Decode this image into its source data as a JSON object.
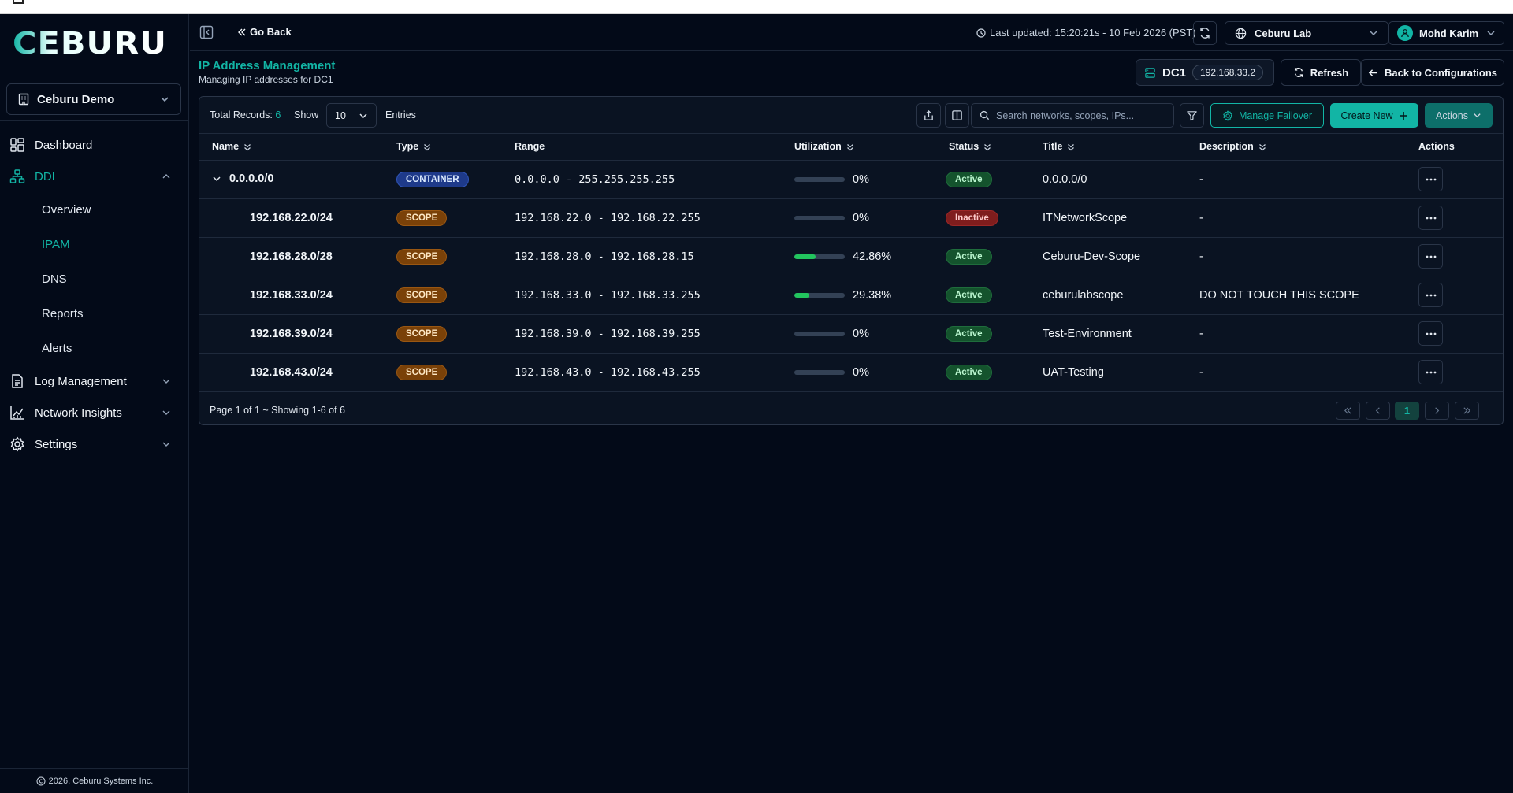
{
  "brand": {
    "logo_text": "CEBURU",
    "accent": "#12b5a5"
  },
  "org_selector": {
    "value": "Ceburu Demo",
    "icon": "building-icon"
  },
  "sidebar": {
    "items": [
      {
        "label": "Dashboard",
        "icon": "dashboard-icon"
      },
      {
        "label": "DDI",
        "icon": "network-icon",
        "expanded": true
      },
      {
        "label": "Log Management",
        "icon": "document-icon"
      },
      {
        "label": "Network Insights",
        "icon": "chart-icon"
      },
      {
        "label": "Settings",
        "icon": "gear-icon"
      }
    ],
    "ddi_sub": [
      "Overview",
      "IPAM",
      "DNS",
      "Reports",
      "Alerts"
    ],
    "active_sub": "IPAM"
  },
  "footer": {
    "text": "2026, Ceburu Systems Inc."
  },
  "topbar": {
    "go_back": "Go Back",
    "last_updated": "Last updated: 15:20:21s - 10 Feb 2026 (PST)",
    "lab": "Ceburu Lab",
    "user": "Mohd Karim"
  },
  "page": {
    "title": "IP Address Management",
    "subtitle": "Managing IP addresses for DC1",
    "dc_name": "DC1",
    "dc_ip": "192.168.33.2",
    "refresh_label": "Refresh",
    "back_label": "Back to Configurations"
  },
  "toolbar": {
    "total_label": "Total Records:",
    "total_value": "6",
    "show_label": "Show",
    "show_value": "10",
    "entries_label": "Entries",
    "search_placeholder": "Search networks, scopes, IPs...",
    "manage_failover": "Manage Failover",
    "create_new": "Create New",
    "actions": "Actions"
  },
  "table": {
    "columns": [
      "Name",
      "Type",
      "Range",
      "Utilization",
      "Status",
      "Title",
      "Description",
      "Actions"
    ],
    "rows": [
      {
        "name": "0.0.0.0/0",
        "type": "CONTAINER",
        "range": "0.0.0.0 - 255.255.255.255",
        "util_label": "0%",
        "util": 0,
        "status": "Active",
        "title": "0.0.0.0/0",
        "description": "-"
      },
      {
        "name": "192.168.22.0/24",
        "type": "SCOPE",
        "range": "192.168.22.0 - 192.168.22.255",
        "util_label": "0%",
        "util": 0,
        "status": "Inactive",
        "title": "ITNetworkScope",
        "description": "-"
      },
      {
        "name": "192.168.28.0/28",
        "type": "SCOPE",
        "range": "192.168.28.0 - 192.168.28.15",
        "util_label": "42.86%",
        "util": 42.86,
        "status": "Active",
        "title": "Ceburu-Dev-Scope",
        "description": "-"
      },
      {
        "name": "192.168.33.0/24",
        "type": "SCOPE",
        "range": "192.168.33.0 - 192.168.33.255",
        "util_label": "29.38%",
        "util": 29.38,
        "status": "Active",
        "title": "ceburulabscope",
        "description": "DO NOT TOUCH THIS SCOPE"
      },
      {
        "name": "192.168.39.0/24",
        "type": "SCOPE",
        "range": "192.168.39.0 - 192.168.39.255",
        "util_label": "0%",
        "util": 0,
        "status": "Active",
        "title": "Test-Environment",
        "description": "-"
      },
      {
        "name": "192.168.43.0/24",
        "type": "SCOPE",
        "range": "192.168.43.0 - 192.168.43.255",
        "util_label": "0%",
        "util": 0,
        "status": "Active",
        "title": "UAT-Testing",
        "description": "-"
      }
    ]
  },
  "pagination": {
    "info": "Page 1 of 1 ~ Showing 1-6 of 6",
    "current": "1"
  }
}
